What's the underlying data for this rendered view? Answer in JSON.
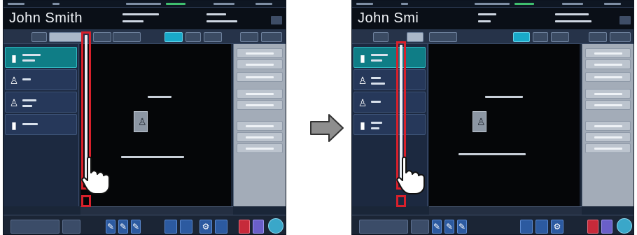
{
  "arrow_label": "",
  "screens": [
    {
      "id": "before",
      "patient_name": "John Smith",
      "exam_icon_1": "▮",
      "exam_icon_2": "♙",
      "exam_icon_3": "♙",
      "exam_icon_4": "▮",
      "thumb_icon": "♙",
      "action": "drag-scrollbar-down"
    },
    {
      "id": "after",
      "patient_name": "John Smi",
      "exam_icon_1": "▮",
      "exam_icon_2": "♙",
      "exam_icon_3": "♙",
      "exam_icon_4": "▮",
      "thumb_icon": "♙",
      "action": "result-after-scroll"
    }
  ],
  "colors": {
    "highlight": "#d9202b",
    "selected_exam": "#0f7d86",
    "active_tab": "#19a9c9",
    "footer_red": "#c62a3a",
    "footer_purple": "#6a5fc8"
  },
  "icons": {
    "gesture": "hand-pointer-icon",
    "transition": "right-arrow-icon",
    "image_thumb": "person-thumbnail-icon"
  }
}
